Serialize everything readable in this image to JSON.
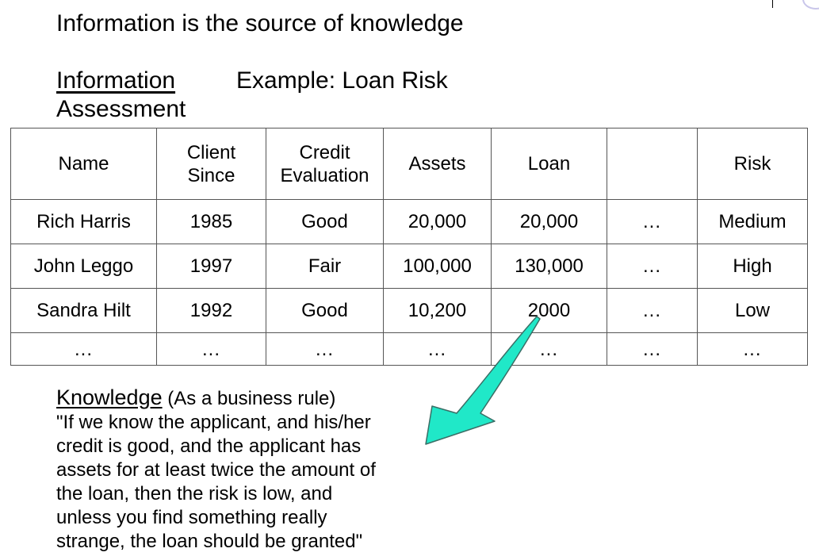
{
  "slide": {
    "title": "Information is the source of knowledge",
    "info_label": "Information",
    "info_label_rest": "Assessment",
    "example_label": "Example: Loan Risk"
  },
  "table": {
    "headers": {
      "name": "Name",
      "client_since_1": "Client",
      "client_since_2": "Since",
      "credit_1": "Credit",
      "credit_2": "Evaluation",
      "assets": "Assets",
      "loan": "Loan",
      "blank": "",
      "risk": "Risk"
    },
    "rows": [
      {
        "name": "Rich Harris",
        "since": "1985",
        "credit": "Good",
        "assets": "20,000",
        "loan": "20,000",
        "more": "...",
        "risk": "Medium"
      },
      {
        "name": "John Leggo",
        "since": "1997",
        "credit": "Fair",
        "assets": "100,000",
        "loan": "130,000",
        "more": "...",
        "risk": "High"
      },
      {
        "name": "Sandra Hilt",
        "since": "1992",
        "credit": "Good",
        "assets": "10,200",
        "loan": "2000",
        "more": "...",
        "risk": "Low"
      }
    ],
    "ellipsis_row": [
      "...",
      "...",
      "...",
      "...",
      "...",
      "...",
      "..."
    ]
  },
  "knowledge": {
    "heading": "Knowledge",
    "note": " (As a business rule)",
    "lines": [
      "\"If we know the applicant, and his/her",
      "credit is good, and the applicant has",
      "assets for at least twice the amount of",
      "the loan, then the risk is low, and",
      "unless you find something really",
      "strange, the loan should be granted\""
    ]
  },
  "colors": {
    "arrow_fill": "#20E8C8",
    "arrow_stroke": "#3a6e66",
    "table_border": "#555555",
    "corner_arc": "#c9c6ea"
  }
}
